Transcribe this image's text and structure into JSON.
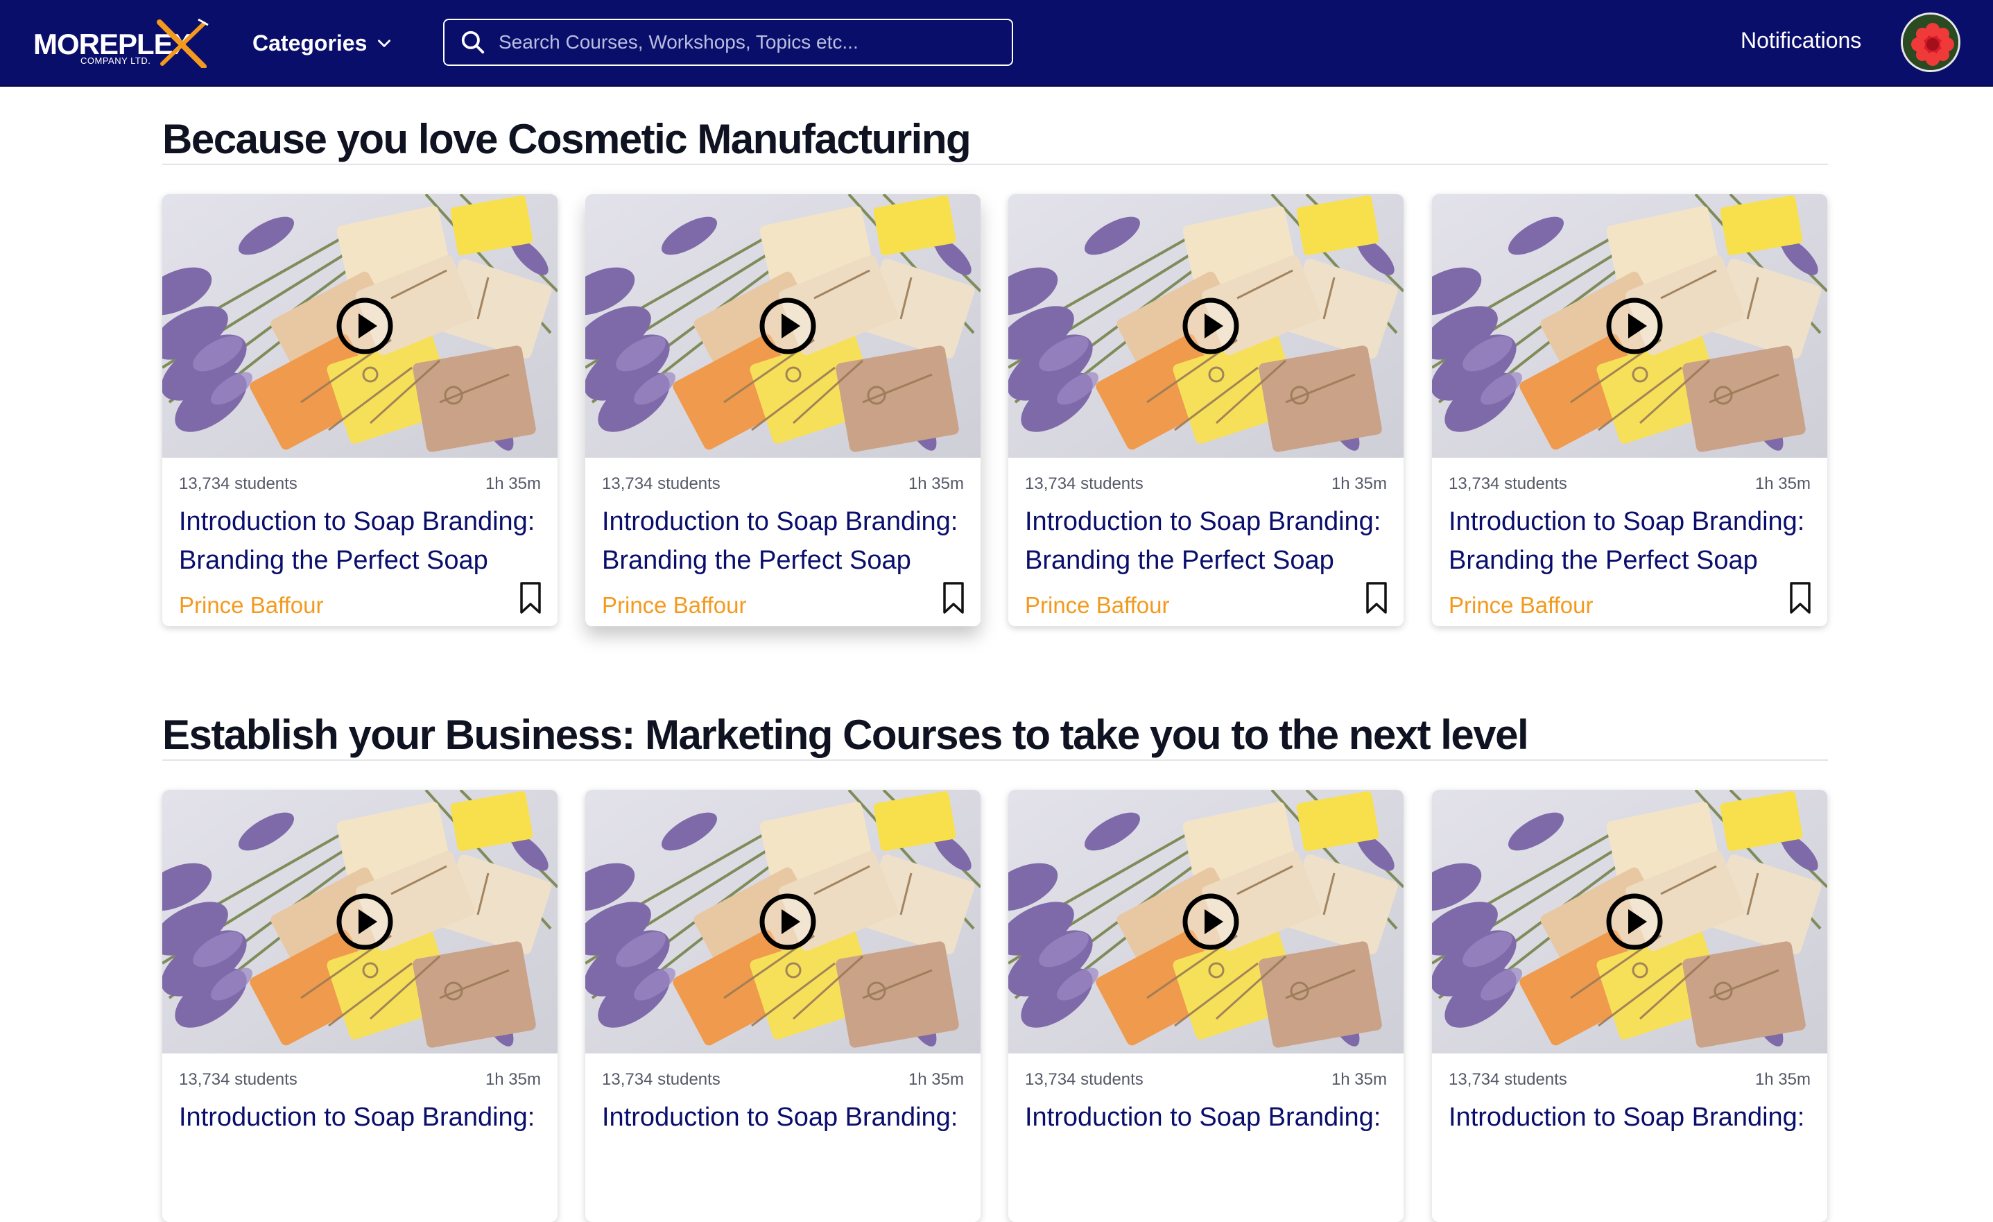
{
  "navbar": {
    "logo_text": "MOREPLEX",
    "logo_sub": "COMPANY LTD.",
    "categories_label": "Categories",
    "search_placeholder": "Search Courses, Workshops, Topics etc...",
    "notifications_label": "Notifications"
  },
  "colors": {
    "nav_bg": "#0a0e6b",
    "title_color": "#0a0e6b",
    "author_color": "#f39a1e"
  },
  "sections": [
    {
      "title": "Because you love Cosmetic Manufacturing",
      "cards": [
        {
          "students": "13,734 students",
          "duration": "1h 35m",
          "title_line1": "Introduction to Soap Branding:",
          "title_line2": "Branding the Perfect Soap",
          "author": "Prince Baffour"
        },
        {
          "students": "13,734 students",
          "duration": "1h 35m",
          "title_line1": "Introduction to Soap Branding:",
          "title_line2": "Branding the Perfect Soap",
          "author": "Prince Baffour"
        },
        {
          "students": "13,734 students",
          "duration": "1h 35m",
          "title_line1": "Introduction to Soap Branding:",
          "title_line2": "Branding the Perfect Soap",
          "author": "Prince Baffour"
        },
        {
          "students": "13,734 students",
          "duration": "1h 35m",
          "title_line1": "Introduction to Soap Branding:",
          "title_line2": "Branding the Perfect Soap",
          "author": "Prince Baffour"
        }
      ]
    },
    {
      "title": "Establish your Business: Marketing Courses to take you to the next level",
      "cards": [
        {
          "students": "13,734 students",
          "duration": "1h 35m",
          "title_line1": "Introduction to Soap Branding:"
        },
        {
          "students": "13,734 students",
          "duration": "1h 35m",
          "title_line1": "Introduction to Soap Branding:"
        },
        {
          "students": "13,734 students",
          "duration": "1h 35m",
          "title_line1": "Introduction to Soap Branding:"
        },
        {
          "students": "13,734 students",
          "duration": "1h 35m",
          "title_line1": "Introduction to Soap Branding:"
        }
      ]
    }
  ]
}
